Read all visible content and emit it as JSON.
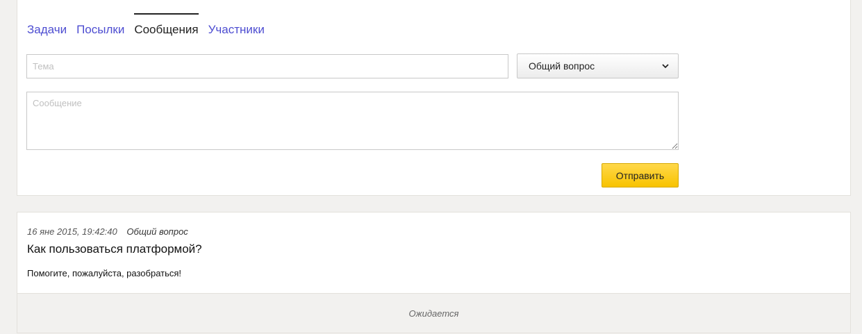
{
  "tabs": [
    {
      "label": "Задачи",
      "active": false
    },
    {
      "label": "Посылки",
      "active": false
    },
    {
      "label": "Сообщения",
      "active": true
    },
    {
      "label": "Участники",
      "active": false
    }
  ],
  "form": {
    "topic_placeholder": "Тема",
    "topic_value": "",
    "category_selected": "Общий вопрос",
    "message_placeholder": "Сообщение",
    "message_value": "",
    "send_label": "Отправить"
  },
  "messages": [
    {
      "datetime": "16 яне 2015, 19:42:40",
      "category": "Общий вопрос",
      "title": "Как пользоваться платформой?",
      "body": "Помогите, пожалуйста, разобраться!",
      "status": "Ожидается"
    }
  ],
  "colors": {
    "link": "#4d4dd1",
    "send_button": "#f8c300",
    "page_background": "#f2f1ef"
  },
  "icons": {
    "select_arrow": "chevron-down-icon"
  }
}
